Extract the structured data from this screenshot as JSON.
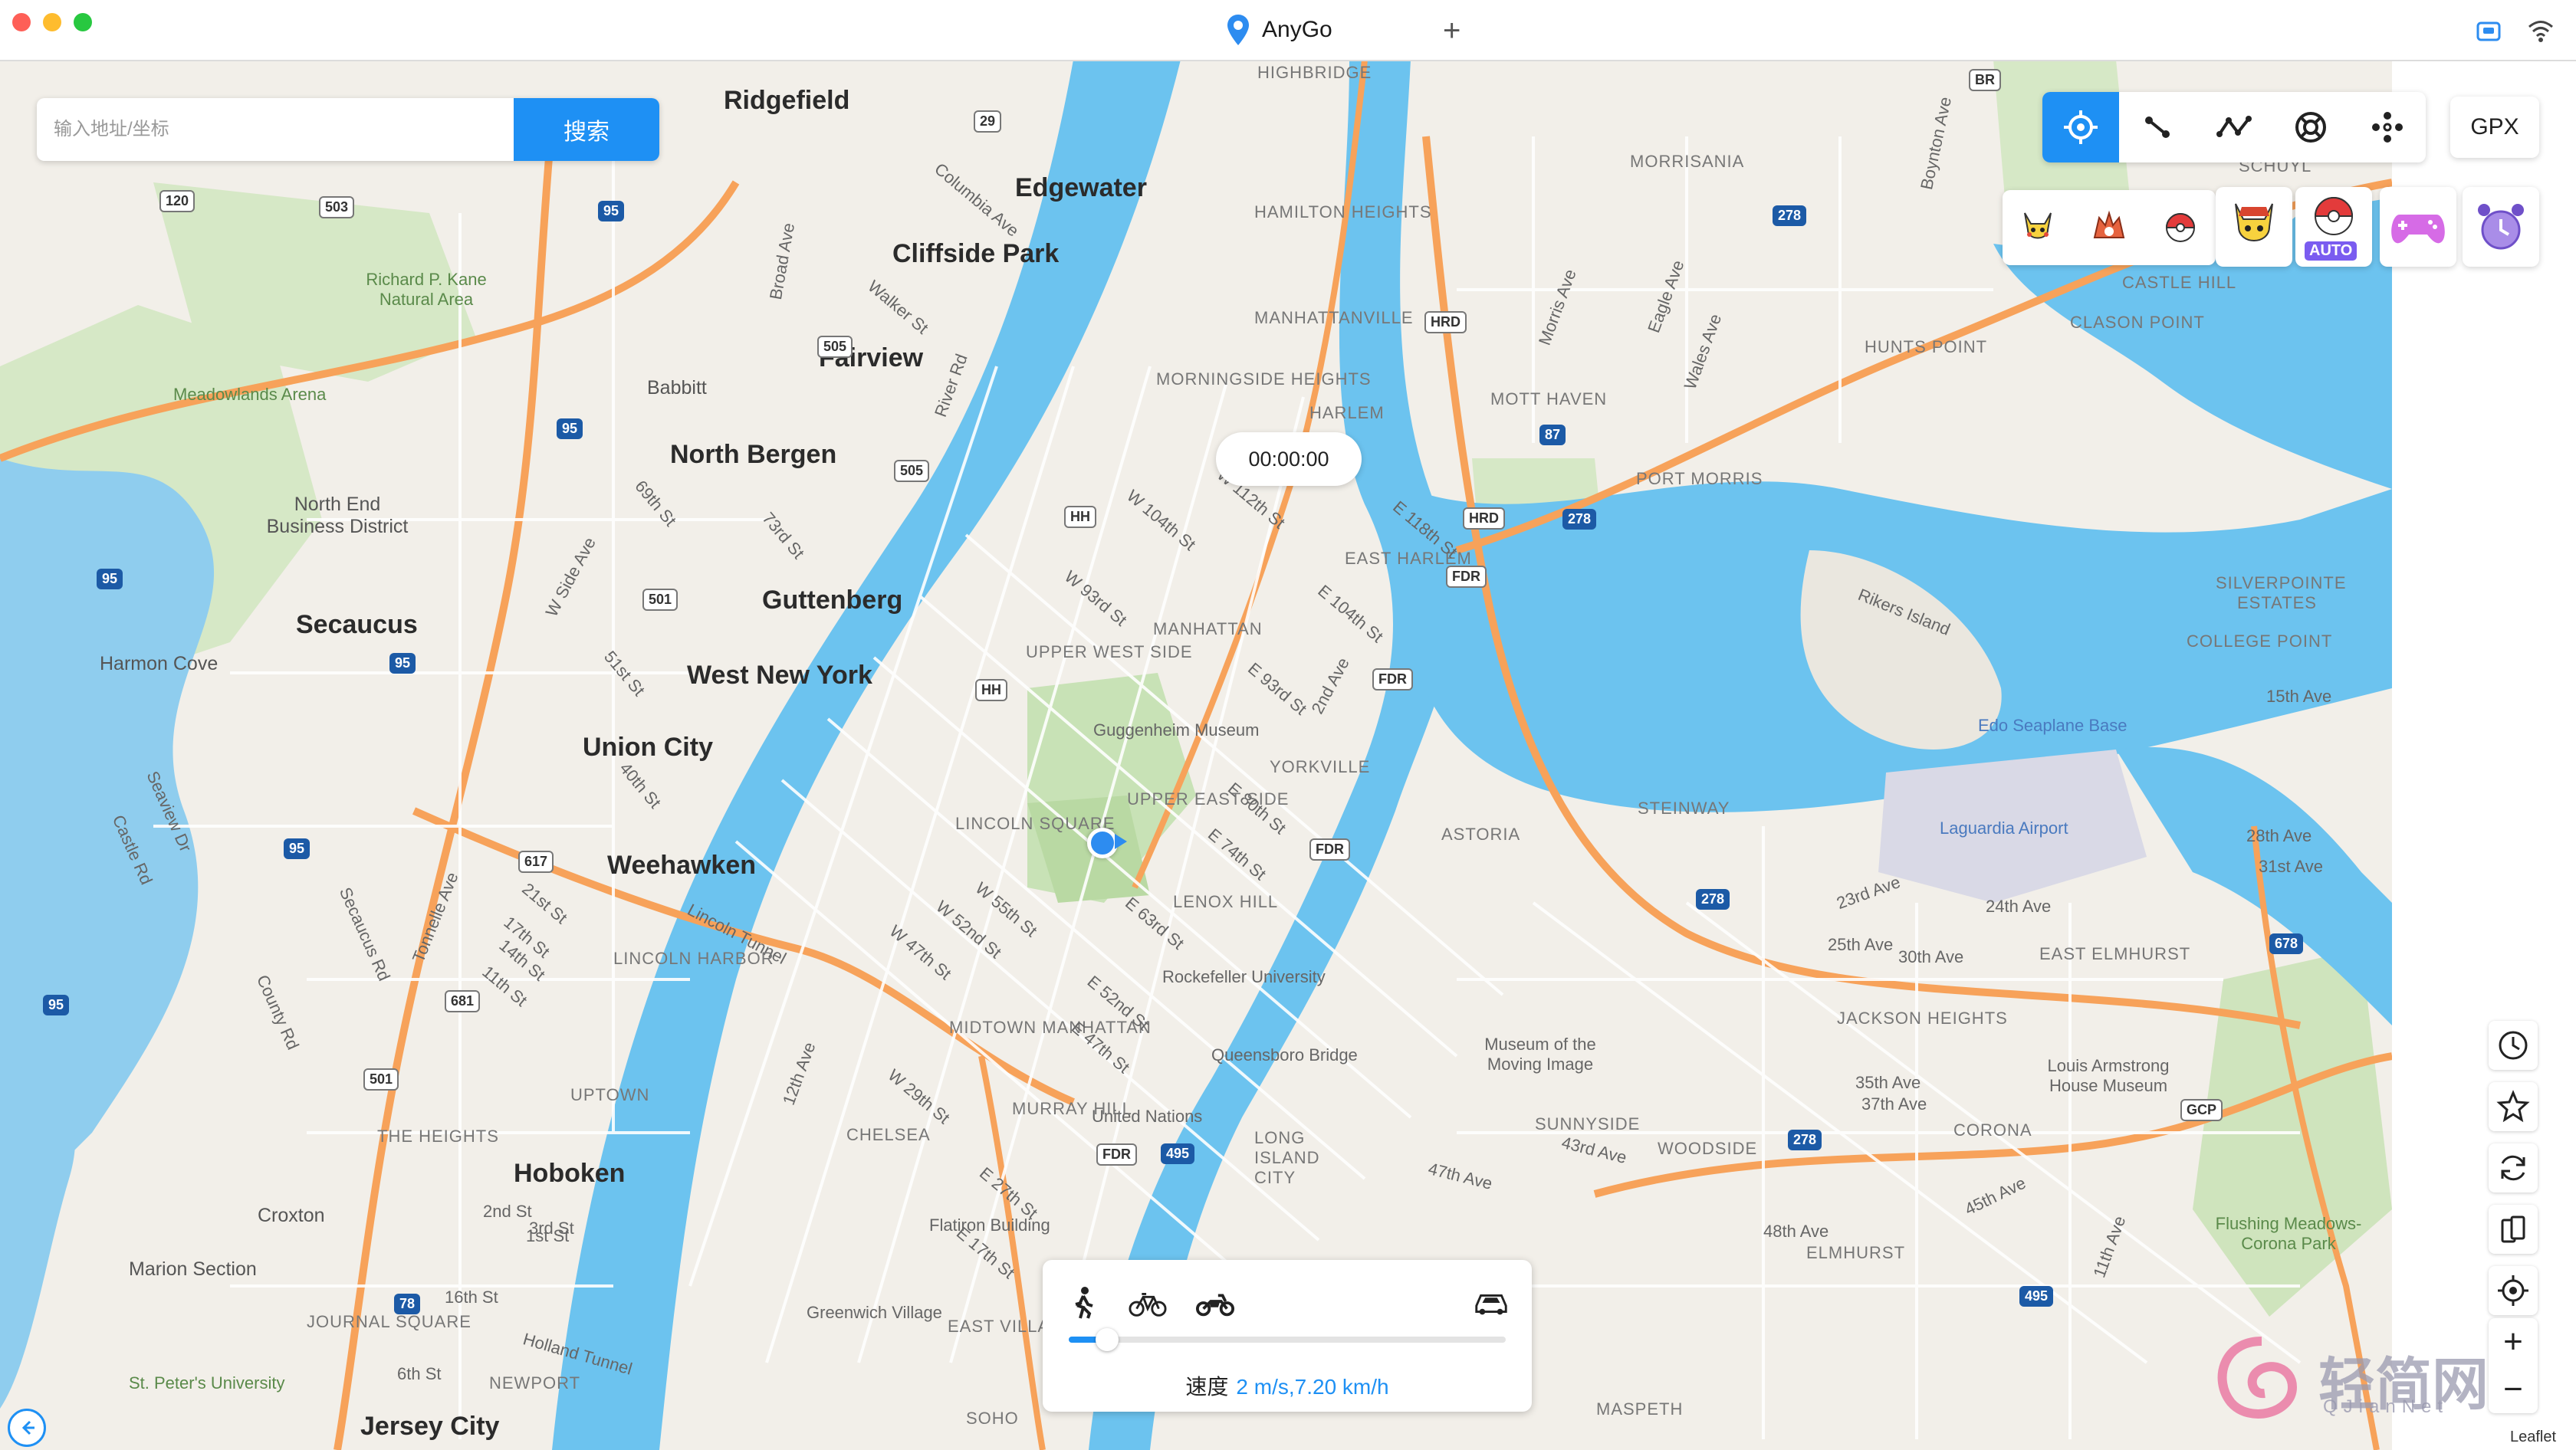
{
  "window": {
    "title": "AnyGo"
  },
  "search": {
    "placeholder": "输入地址/坐标",
    "button_label": "搜索"
  },
  "toolbar": {
    "modes": [
      "teleport-mode",
      "two-spot-mode",
      "multi-spot-mode",
      "jump-teleport-mode",
      "joystick-mode"
    ],
    "active_mode": "teleport-mode",
    "gpx_label": "GPX",
    "auto_badge": "AUTO"
  },
  "timer": {
    "value": "00:00:00"
  },
  "speed_panel": {
    "label": "速度",
    "value": "2 m/s,7.20 km/h",
    "modes": [
      "walk-icon",
      "bicycle-icon",
      "motorcycle-icon",
      "car-icon"
    ],
    "level": 0.04
  },
  "map": {
    "attribution": "Leaflet",
    "places_big": [
      "Ridgefield",
      "Edgewater",
      "Cliffside Park",
      "Fairview",
      "North Bergen",
      "Guttenberg",
      "Secaucus",
      "West New York",
      "Union City",
      "Weehawken",
      "Hoboken",
      "Jersey City"
    ],
    "places_mid": [
      "Babbitt",
      "North End Business District",
      "Harmon Cove",
      "Richard P. Kane Natural Area",
      "Meadowlands Arena",
      "Croxton",
      "Marion Section",
      "St. Peter's University",
      "Lincoln Tunnel",
      "Holland Tunnel",
      "Guggenheim Museum",
      "Rockefeller University",
      "Queensboro Bridge",
      "United Nations",
      "Flatiron Building",
      "Greenwich Village",
      "Museum of the Moving Image",
      "Edo Seaplane Base",
      "Laguardia Airport",
      "Louis Armstrong House Museum",
      "Flushing Meadows-Corona Park",
      "Rikers Island"
    ],
    "districts": [
      "HAMILTON HEIGHTS",
      "MANHATTANVILLE",
      "MORNINGSIDE HEIGHTS",
      "HARLEM",
      "EAST HARLEM",
      "UPPER WEST SIDE",
      "MANHATTAN",
      "UPPER EAST SIDE",
      "YORKVILLE",
      "LINCOLN SQUARE",
      "LENOX HILL",
      "MIDTOWN MANHATTAN",
      "MURRAY HILL",
      "CHELSEA",
      "EAST VILLAGE",
      "SOHO",
      "LINCOLN HARBOR",
      "UPTOWN",
      "THE HEIGHTS",
      "JOURNAL SQUARE",
      "NEWPORT",
      "MORRISANIA",
      "MOTT HAVEN",
      "PORT MORRIS",
      "HUNTS POINT",
      "CLASON POINT",
      "CASTLE HILL",
      "ASTORIA",
      "STEINWAY",
      "JACKSON HEIGHTS",
      "EAST ELMHURST",
      "CORONA",
      "WOODSIDE",
      "SUNNYSIDE",
      "LONG ISLAND CITY",
      "ELMHURST",
      "MASPETH",
      "SILVERPOINTE ESTATES",
      "COLLEGE POINT",
      "HIGHBRIDGE",
      "SCHUYL"
    ],
    "streets": [
      "W 104th St",
      "W 93rd St",
      "W 112th St",
      "E 118th St",
      "E 104th St",
      "E 93rd St",
      "2nd Ave",
      "E 80th St",
      "E 74th St",
      "E 63rd St",
      "W 55th St",
      "W 52nd St",
      "W 47th St",
      "E 52nd St",
      "E 47th St",
      "W 29th St",
      "E 27th St",
      "E 17th St",
      "12th Ave",
      "Broad Ave",
      "Walker St",
      "Columbia Ave",
      "River Rd",
      "69th St",
      "73rd St",
      "W Side Ave",
      "51st St",
      "40th St",
      "Tonnelle Ave",
      "Secaucus Rd",
      "County Rd",
      "Seaview Dr",
      "Castle Rd",
      "21st St",
      "17th St",
      "14th St",
      "11th St",
      "2nd St",
      "3rd St",
      "1st St",
      "16th St",
      "6th St",
      "23rd Ave",
      "24th Ave",
      "25th Ave",
      "30th Ave",
      "35th Ave",
      "37th Ave",
      "43rd Ave",
      "45th Ave",
      "47th Ave",
      "48th Ave",
      "11th Ave",
      "15th Ave",
      "28th Ave",
      "31st Ave",
      "Boynton Ave",
      "Morris Ave",
      "Eagle Ave",
      "Wales Ave"
    ]
  }
}
